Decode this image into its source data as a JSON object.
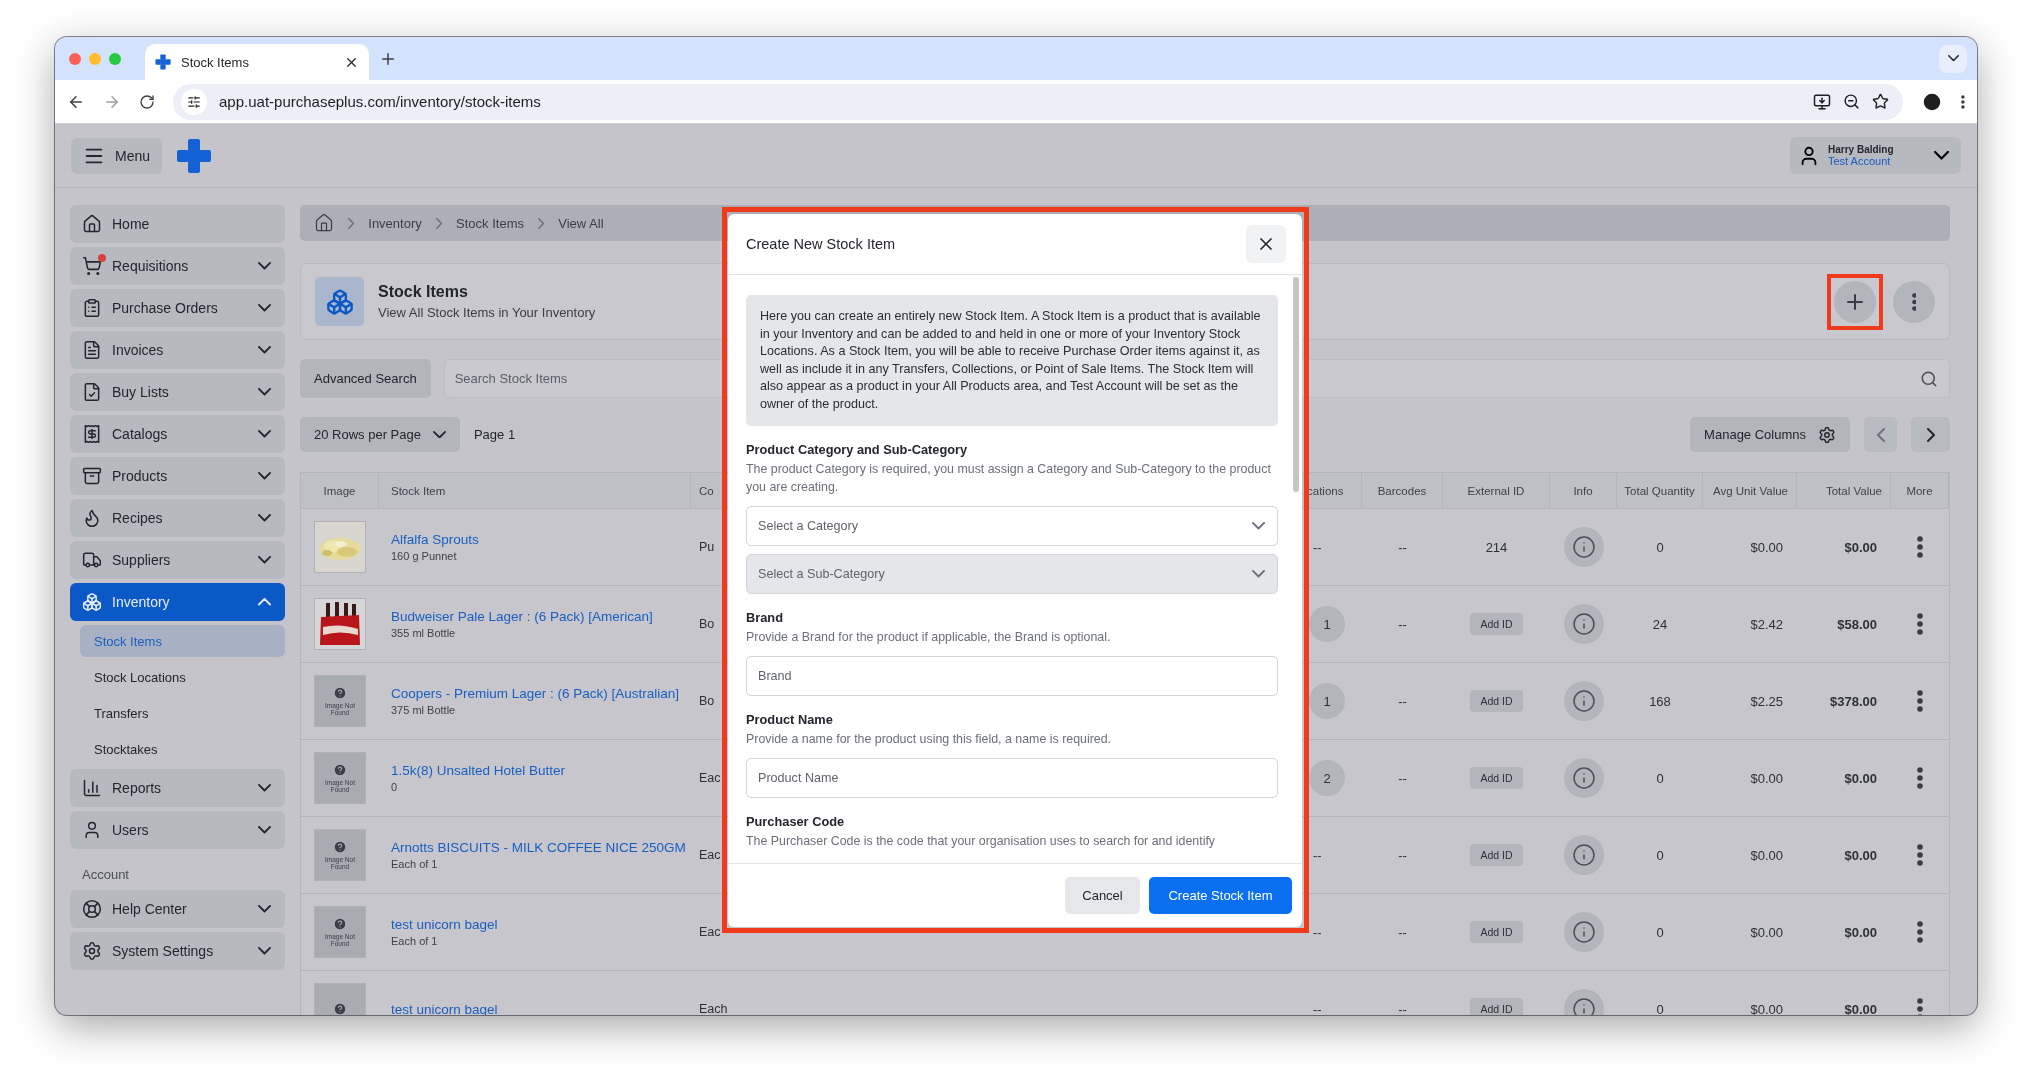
{
  "browser": {
    "tab_title": "Stock Items",
    "url": "app.uat-purchaseplus.com/inventory/stock-items"
  },
  "header": {
    "menu_label": "Menu",
    "user": {
      "name": "Harry Balding",
      "account": "Test Account"
    }
  },
  "sidebar": {
    "items": [
      {
        "label": "Home",
        "expandable": false,
        "selected": false,
        "alert": false
      },
      {
        "label": "Requisitions",
        "expandable": true,
        "expanded": false,
        "selected": false,
        "alert": true
      },
      {
        "label": "Purchase Orders",
        "expandable": true,
        "expanded": false,
        "selected": false,
        "alert": false
      },
      {
        "label": "Invoices",
        "expandable": true,
        "expanded": false,
        "selected": false,
        "alert": false
      },
      {
        "label": "Buy Lists",
        "expandable": true,
        "expanded": false,
        "selected": false,
        "alert": false
      },
      {
        "label": "Catalogs",
        "expandable": true,
        "expanded": false,
        "selected": false,
        "alert": false
      },
      {
        "label": "Products",
        "expandable": true,
        "expanded": false,
        "selected": false,
        "alert": false
      },
      {
        "label": "Recipes",
        "expandable": true,
        "expanded": false,
        "selected": false,
        "alert": false
      },
      {
        "label": "Suppliers",
        "expandable": true,
        "expanded": false,
        "selected": false,
        "alert": false
      },
      {
        "label": "Inventory",
        "expandable": true,
        "expanded": true,
        "selected": true,
        "alert": false,
        "children": [
          {
            "label": "Stock Items",
            "selected": true
          },
          {
            "label": "Stock Locations",
            "selected": false
          },
          {
            "label": "Transfers",
            "selected": false
          },
          {
            "label": "Stocktakes",
            "selected": false
          }
        ]
      },
      {
        "label": "Reports",
        "expandable": true,
        "expanded": false,
        "selected": false,
        "alert": false
      },
      {
        "label": "Users",
        "expandable": true,
        "expanded": false,
        "selected": false,
        "alert": false
      }
    ],
    "section_label": "Account",
    "account_items": [
      {
        "label": "Help Center",
        "expandable": true,
        "expanded": false,
        "selected": false,
        "alert": false
      },
      {
        "label": "System Settings",
        "expandable": true,
        "expanded": false,
        "selected": false,
        "alert": false
      }
    ]
  },
  "breadcrumb": [
    "Inventory",
    "Stock Items",
    "View All"
  ],
  "page_header": {
    "title": "Stock Items",
    "subtitle": "View All Stock Items in Your Inventory",
    "add_highlighted": true
  },
  "search": {
    "advanced_label": "Advanced Search",
    "placeholder": "Search Stock Items"
  },
  "pager": {
    "rows_per_page": "20 Rows per Page",
    "page": "Page 1",
    "manage_columns": "Manage Columns"
  },
  "table": {
    "columns": [
      "Image",
      "Stock Item",
      "Co",
      "cations",
      "Barcodes",
      "External ID",
      "Info",
      "Total Quantity",
      "Avg Unit Value",
      "Total Value",
      "More"
    ],
    "rows": [
      {
        "name": "Alfalfa Sprouts",
        "unit": "160 g Punnet",
        "column_3": "Pu",
        "locations": {
          "kind": "text",
          "text": "--"
        },
        "barcodes": "--",
        "external_id": {
          "kind": "text",
          "text": "214"
        },
        "total_quantity": "0",
        "avg_unit_value": "$0.00",
        "total_value": "$0.00"
      },
      {
        "name": "Budweiser Pale Lager : (6 Pack) [American]",
        "unit": "355 ml Bottle",
        "column_3": "Bo",
        "locations": {
          "kind": "badge",
          "text": "1"
        },
        "barcodes": "--",
        "external_id": {
          "kind": "button",
          "text": "Add ID"
        },
        "total_quantity": "24",
        "avg_unit_value": "$2.42",
        "total_value": "$58.00"
      },
      {
        "image": {
          "kind": "missing",
          "text": "Image Not Found"
        },
        "name": "Coopers - Premium Lager : (6 Pack) [Australian]",
        "unit": "375 ml Bottle",
        "column_3": "Bo",
        "locations": {
          "kind": "badge",
          "text": "1"
        },
        "barcodes": "--",
        "external_id": {
          "kind": "button",
          "text": "Add ID"
        },
        "total_quantity": "168",
        "avg_unit_value": "$2.25",
        "total_value": "$378.00"
      },
      {
        "image": {
          "kind": "missing",
          "text": "Image Not Found"
        },
        "name": "1.5k(8) Unsalted Hotel Butter",
        "unit": "0",
        "column_3": "Eac",
        "locations": {
          "kind": "badge",
          "text": "2"
        },
        "barcodes": "--",
        "external_id": {
          "kind": "button",
          "text": "Add ID"
        },
        "total_quantity": "0",
        "avg_unit_value": "$0.00",
        "total_value": "$0.00"
      },
      {
        "image": {
          "kind": "missing",
          "text": "Image Not Found"
        },
        "name": "Arnotts BISCUITS - MILK COFFEE NICE 250GM",
        "unit": "Each of 1",
        "column_3": "Eac",
        "locations": {
          "kind": "text",
          "text": "--"
        },
        "barcodes": "--",
        "external_id": {
          "kind": "button",
          "text": "Add ID"
        },
        "total_quantity": "0",
        "avg_unit_value": "$0.00",
        "total_value": "$0.00"
      },
      {
        "image": {
          "kind": "missing",
          "text": "Image Not Found"
        },
        "name": "test unicorn bagel",
        "unit": "Each of 1",
        "column_3": "Eac",
        "locations": {
          "kind": "text",
          "text": "--"
        },
        "barcodes": "--",
        "external_id": {
          "kind": "button",
          "text": "Add ID"
        },
        "total_quantity": "0",
        "avg_unit_value": "$0.00",
        "total_value": "$0.00"
      },
      {
        "image": {
          "kind": "missing"
        },
        "name": "test unicorn bagel",
        "column_3": "Each",
        "locations": {
          "kind": "text",
          "text": "--"
        },
        "barcodes": "--",
        "external_id": {
          "kind": "button",
          "text": "Add ID"
        },
        "total_quantity": "0",
        "avg_unit_value": "$0.00",
        "total_value": "$0.00"
      }
    ]
  },
  "modal": {
    "title": "Create New Stock Item",
    "highlighted": true,
    "intro": "Here you can create an entirely new Stock Item. A Stock Item is a product that is available in your Inventory and can be added to and held in one or more of your Inventory Stock Locations. As a Stock Item, you will be able to receive Purchase Order items against it, as well as include it in any Transfers, Collections, or Point of Sale Items. The Stock Item will also appear as a product in your All Products area, and Test Account will be set as the owner of the product.",
    "sections": [
      {
        "title": "Product Category and Sub-Category",
        "description": "The product Category is required, you must assign a Category and Sub-Category to the product you are creating.",
        "fields": [
          {
            "kind": "select",
            "placeholder": "Select a Category",
            "disabled": false
          },
          {
            "kind": "select",
            "placeholder": "Select a Sub-Category",
            "disabled": true
          }
        ]
      },
      {
        "title": "Brand",
        "description": "Provide a Brand for the product if applicable, the Brand is optional.",
        "fields": [
          {
            "kind": "input",
            "placeholder": "Brand",
            "disabled": false
          }
        ]
      },
      {
        "title": "Product Name",
        "description": "Provide a name for the product using this field, a name is required.",
        "fields": [
          {
            "kind": "input",
            "placeholder": "Product Name",
            "disabled": false
          }
        ]
      },
      {
        "title": "Purchaser Code",
        "description": "The Purchaser Code is the code that your organisation uses to search for and identify"
      }
    ],
    "buttons": [
      {
        "label": "Cancel",
        "kind": "secondary"
      },
      {
        "label": "Create Stock Item",
        "kind": "primary"
      }
    ]
  }
}
